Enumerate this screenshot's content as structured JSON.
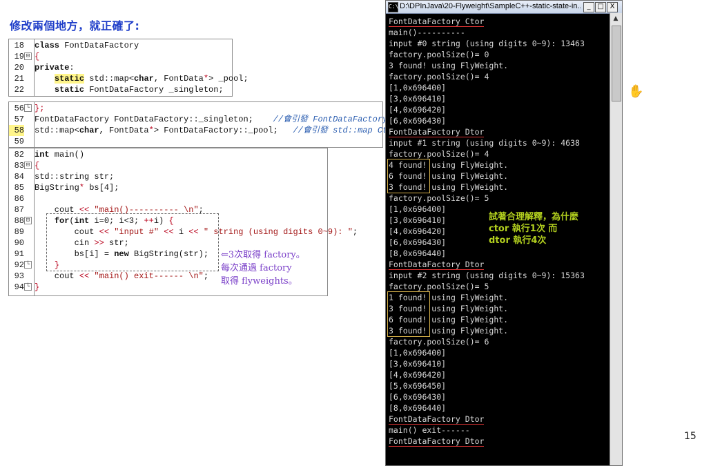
{
  "slide": {
    "title": "修改兩個地方，就正確了:",
    "page_number": "15"
  },
  "code_block1": [
    {
      "num": "18",
      "fold": "",
      "parts": [
        [
          "kb",
          "class"
        ],
        [
          "ty",
          " FontDataFactory"
        ]
      ]
    },
    {
      "num": "19",
      "fold": "⊟",
      "parts": [
        [
          "op",
          "{"
        ]
      ]
    },
    {
      "num": "20",
      "fold": "",
      "parts": [
        [
          "kb",
          "private"
        ],
        [
          "ty",
          ":"
        ]
      ]
    },
    {
      "num": "21",
      "fold": "",
      "parts": [
        [
          "ty",
          "    "
        ],
        [
          "kbhl",
          "static"
        ],
        [
          "ty",
          " std::map<"
        ],
        [
          "kb",
          "char"
        ],
        [
          "ty",
          ", FontData"
        ],
        [
          "op",
          "*"
        ],
        [
          "ty",
          "> _pool;"
        ]
      ]
    },
    {
      "num": "22",
      "fold": "",
      "parts": [
        [
          "ty",
          "    "
        ],
        [
          "kb",
          "static"
        ],
        [
          "ty",
          " FontDataFactory _singleton;"
        ]
      ]
    }
  ],
  "code_block2": [
    {
      "num": "56",
      "fold": "└",
      "parts": [
        [
          "op",
          "};"
        ]
      ]
    },
    {
      "num": "57",
      "fold": "",
      "parts": [
        [
          "ty",
          "FontDataFactory FontDataFactory::_singleton;    "
        ],
        [
          "cm",
          "//會引發 FontDataFactory Ctor"
        ]
      ]
    },
    {
      "num": "58",
      "fold": "",
      "parts": [
        [
          "ty",
          "std::map<"
        ],
        [
          "kb",
          "char"
        ],
        [
          "ty",
          ", FontData"
        ],
        [
          "op",
          "*"
        ],
        [
          "ty",
          "> FontDataFactory::_pool;   "
        ],
        [
          "cm",
          "//會引發 std::map Ctor"
        ]
      ]
    },
    {
      "num": "59",
      "fold": "",
      "parts": []
    }
  ],
  "code_block3": [
    {
      "num": "82",
      "fold": "",
      "parts": [
        [
          "kb",
          "int"
        ],
        [
          "ty",
          " main()"
        ]
      ]
    },
    {
      "num": "83",
      "fold": "⊟",
      "parts": [
        [
          "op",
          "{"
        ]
      ]
    },
    {
      "num": "84",
      "fold": "",
      "parts": [
        [
          "ty",
          "std::string str;"
        ]
      ]
    },
    {
      "num": "85",
      "fold": "",
      "parts": [
        [
          "ty",
          "BigString"
        ],
        [
          "op",
          "*"
        ],
        [
          "ty",
          " bs[4];"
        ]
      ]
    },
    {
      "num": "86",
      "fold": "",
      "parts": []
    },
    {
      "num": "87",
      "fold": "",
      "parts": [
        [
          "ty",
          "    cout "
        ],
        [
          "op",
          "<<"
        ],
        [
          "s",
          " \"main()---------- \\n\""
        ],
        [
          "ty",
          ";"
        ]
      ]
    },
    {
      "num": "88",
      "fold": "⊟",
      "parts": [
        [
          "ty",
          "    "
        ],
        [
          "kb",
          "for"
        ],
        [
          "ty",
          "("
        ],
        [
          "kb",
          "int"
        ],
        [
          "ty",
          " i=0; i<3; "
        ],
        [
          "op",
          "++"
        ],
        [
          "ty",
          "i) "
        ],
        [
          "op",
          "{"
        ]
      ]
    },
    {
      "num": "89",
      "fold": "",
      "parts": [
        [
          "ty",
          "        cout "
        ],
        [
          "op",
          "<<"
        ],
        [
          "s",
          " \"input #\""
        ],
        [
          "ty",
          " "
        ],
        [
          "op",
          "<<"
        ],
        [
          "ty",
          " i "
        ],
        [
          "op",
          "<<"
        ],
        [
          "s",
          " \" string (using digits 0~9): \""
        ],
        [
          "ty",
          ";"
        ]
      ]
    },
    {
      "num": "90",
      "fold": "",
      "parts": [
        [
          "ty",
          "        cin "
        ],
        [
          "op",
          ">>"
        ],
        [
          "ty",
          " str;"
        ]
      ]
    },
    {
      "num": "91",
      "fold": "",
      "parts": [
        [
          "ty",
          "        bs[i] = "
        ],
        [
          "kb",
          "new"
        ],
        [
          "ty",
          " BigString(str);"
        ]
      ]
    },
    {
      "num": "92",
      "fold": "└",
      "parts": [
        [
          "ty",
          "    "
        ],
        [
          "op",
          "}"
        ]
      ]
    },
    {
      "num": "93",
      "fold": "",
      "parts": [
        [
          "ty",
          "    cout "
        ],
        [
          "op",
          "<<"
        ],
        [
          "s",
          " \"main() exit------ \\n\""
        ],
        [
          "ty",
          ";"
        ]
      ]
    },
    {
      "num": "94",
      "fold": "└",
      "parts": [
        [
          "op",
          "}"
        ]
      ]
    }
  ],
  "annotation": {
    "line1": "⇐3次取得 factory。",
    "line2": "每次通過 factory",
    "line3": "取得 flyweights。"
  },
  "green_note": "試著合理解釋，為什麼\nctor 執行1次 而\ndtor 執行4次",
  "console_window": {
    "title": "D:\\DPInJava\\20-Flyweight\\SampleC++-static-state-in...",
    "minimize": "_",
    "maximize": "□",
    "close": "X",
    "lines": [
      "FontDataFactory Ctor",
      "main()----------",
      "input #0 string (using digits 0~9): 13463",
      "factory.poolSize()= 0",
      "3 found! using FlyWeight.",
      "factory.poolSize()= 4",
      "[1,0x696400]",
      "[3,0x696410]",
      "[4,0x696420]",
      "[6,0x696430]",
      "FontDataFactory Dtor",
      "input #1 string (using digits 0~9): 4638",
      "factory.poolSize()= 4",
      "4 found! using FlyWeight.",
      "6 found! using FlyWeight.",
      "3 found! using FlyWeight.",
      "factory.poolSize()= 5",
      "[1,0x696400]",
      "[3,0x696410]",
      "[4,0x696420]",
      "[6,0x696430]",
      "[8,0x696440]",
      "FontDataFactory Dtor",
      "input #2 string (using digits 0~9): 15363",
      "factory.poolSize()= 5",
      "1 found! using FlyWeight.",
      "3 found! using FlyWeight.",
      "6 found! using FlyWeight.",
      "3 found! using FlyWeight.",
      "factory.poolSize()= 6",
      "[1,0x696400]",
      "[3,0x696410]",
      "[4,0x696420]",
      "[5,0x696450]",
      "[6,0x696430]",
      "[8,0x696440]",
      "FontDataFactory Dtor",
      "main() exit------",
      "FontDataFactory Dtor"
    ],
    "underlined": [
      0,
      10,
      22,
      36,
      38
    ],
    "boxed": [
      [
        13,
        15
      ],
      [
        25,
        28
      ]
    ]
  }
}
